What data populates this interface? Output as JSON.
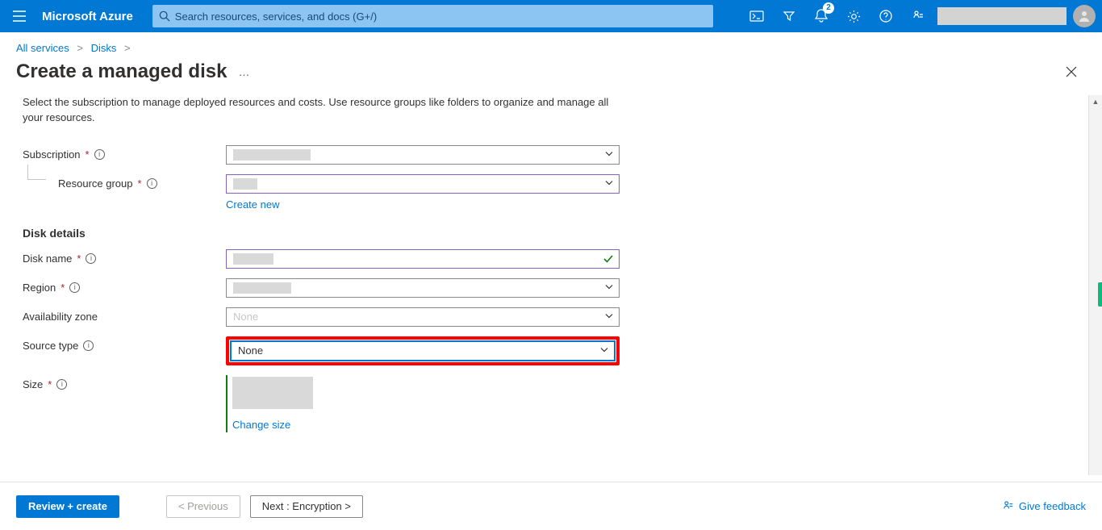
{
  "brand": "Microsoft Azure",
  "search_placeholder": "Search resources, services, and docs (G+/)",
  "notification_count": "2",
  "breadcrumb": {
    "seg1": "All services",
    "seg2": "Disks",
    "sep": ">"
  },
  "page_title": "Create a managed disk",
  "more_glyph": "…",
  "close_glyph": "✕",
  "description": "Select the subscription to manage deployed resources and costs. Use resource groups like folders to organize and manage all your resources.",
  "labels": {
    "subscription": "Subscription",
    "resource_group": "Resource group",
    "disk_name": "Disk name",
    "region": "Region",
    "availability_zone": "Availability zone",
    "source_type": "Source type",
    "size": "Size",
    "disk_details": "Disk details"
  },
  "values": {
    "subscription": "",
    "resource_group": "",
    "disk_name": "",
    "region": "",
    "availability_zone": "None",
    "source_type": "None"
  },
  "links": {
    "create_new": "Create new",
    "change_size": "Change size"
  },
  "footer": {
    "review": "Review + create",
    "previous": "< Previous",
    "next": "Next : Encryption >",
    "feedback": "Give feedback"
  },
  "colors": {
    "primary": "#0078d4",
    "accent_purple": "#8661c5",
    "success": "#107c10",
    "highlight_red": "#ff0000"
  }
}
